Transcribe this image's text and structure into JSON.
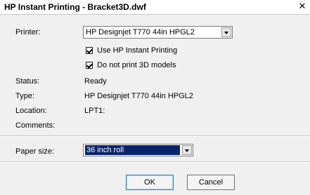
{
  "window": {
    "title": "HP Instant Printing - Bracket3D.dwf",
    "close_label": "✕"
  },
  "form": {
    "printer_label": "Printer:",
    "printer_value": "HP Designjet T770 44in HPGL2",
    "use_instant_label": "Use HP Instant Printing",
    "use_instant_checked": true,
    "no3d_label": "Do not print 3D models",
    "no3d_checked": true,
    "status_label": "Status:",
    "status_value": "Ready",
    "type_label": "Type:",
    "type_value": "HP Designjet T770 44in HPGL2",
    "location_label": "Location:",
    "location_value": "LPT1:",
    "comments_label": "Comments:",
    "comments_value": "",
    "paper_label": "Paper size:",
    "paper_value": "36 inch roll"
  },
  "buttons": {
    "ok": "OK",
    "cancel": "Cancel"
  },
  "colors": {
    "selection": "#0a246a",
    "panel": "#f0f0f0"
  }
}
